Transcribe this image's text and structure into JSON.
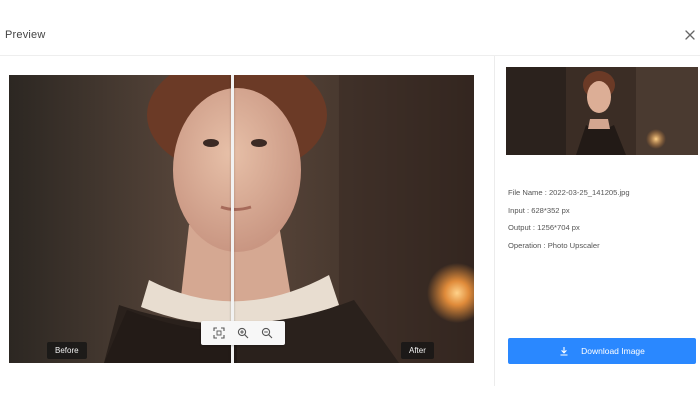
{
  "dialog": {
    "title": "Preview",
    "close_icon": "close-icon"
  },
  "preview": {
    "before_label": "Before",
    "after_label": "After",
    "split_position": 0.48,
    "tools": [
      {
        "icon": "fit-to-screen-icon"
      },
      {
        "icon": "zoom-in-icon"
      },
      {
        "icon": "zoom-out-icon"
      }
    ]
  },
  "info": {
    "file_name_label": "File Name :",
    "file_name": "2022-03-25_141205.jpg",
    "input_label": "Input :",
    "input": "628*352 px",
    "output_label": "Output :",
    "output": "1256*704 px",
    "operation_label": "Operation :",
    "operation": "Photo Upscaler"
  },
  "actions": {
    "download_label": "Download Image",
    "download_icon": "download-icon"
  },
  "colors": {
    "accent": "#2a88ff"
  }
}
